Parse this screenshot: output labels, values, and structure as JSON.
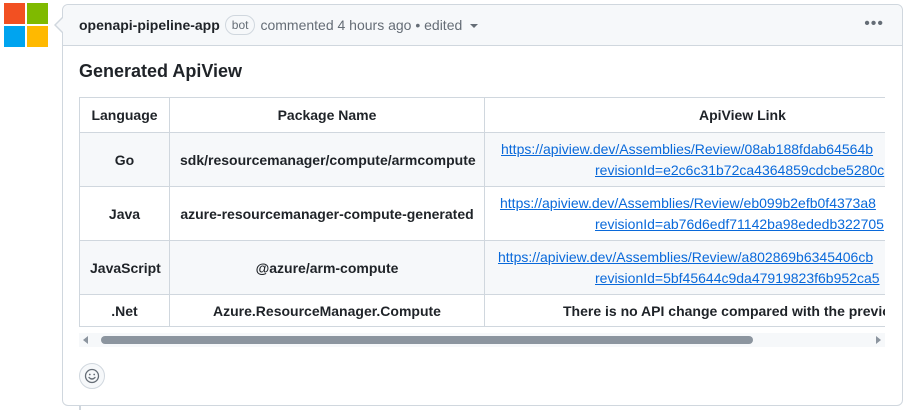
{
  "comment": {
    "author": "openapi-pipeline-app",
    "badge": "bot",
    "meta": "commented 4 hours ago • edited",
    "more_icon": "kebab-horizontal-icon",
    "title": "Generated ApiView"
  },
  "table": {
    "headers": [
      "Language",
      "Package Name",
      "ApiView Link"
    ],
    "rows": [
      {
        "language": "Go",
        "package": "sdk/resourcemanager/compute/armcompute",
        "link_line1": "https://apiview.dev/Assemblies/Review/08ab188fdab64564b",
        "link_line2": "revisionId=e2c6c31b72ca4364859cdcbe5280c"
      },
      {
        "language": "Java",
        "package": "azure-resourcemanager-compute-generated",
        "link_line1": "https://apiview.dev/Assemblies/Review/eb099b2efb0f4373a8",
        "link_line2": "revisionId=ab76d6edf71142ba98ededb322705"
      },
      {
        "language": "JavaScript",
        "package": "@azure/arm-compute",
        "link_line1": "https://apiview.dev/Assemblies/Review/a802869b6345406cb",
        "link_line2": "revisionId=5bf45644c9da47919823f6b952ca5"
      },
      {
        "language": ".Net",
        "package": "Azure.ResourceManager.Compute",
        "note": "There is no API change compared with the previous"
      }
    ]
  },
  "colors": {
    "link": "#0969da",
    "border": "#d0d7de",
    "header_bg": "#f6f8fa"
  }
}
